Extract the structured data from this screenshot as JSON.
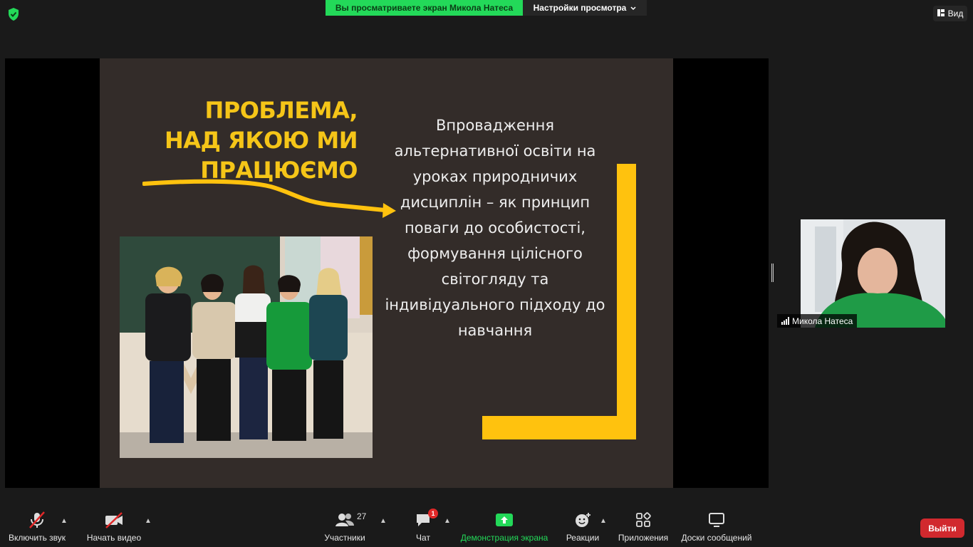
{
  "topbar": {
    "sharing_banner": "Вы просматриваете экран Микола Натеса",
    "view_options": "Настройки просмотра",
    "view_button": "Вид"
  },
  "slide": {
    "title": "ПРОБЛЕМА,\nНАД ЯКОЮ МИ\nПРАЦЮЄМО",
    "body": "Впровадження альтернативної освіти на уроках природничих дисциплін – як принцип поваги до особистості, формування цілісного світогляду та індивідуального підходу до навчання"
  },
  "participant": {
    "name": "Микола Натеса"
  },
  "toolbar": {
    "unmute": "Включить звук",
    "start_video": "Начать видео",
    "participants": "Участники",
    "participants_count": "27",
    "chat": "Чат",
    "chat_badge": "1",
    "share_screen": "Демонстрация экрана",
    "reactions": "Реакции",
    "apps": "Приложения",
    "whiteboards": "Доски сообщений",
    "leave": "Выйти"
  },
  "colors": {
    "accent_green": "#23d959",
    "slide_yellow": "#ffc20e",
    "leave_red": "#d1292e"
  }
}
